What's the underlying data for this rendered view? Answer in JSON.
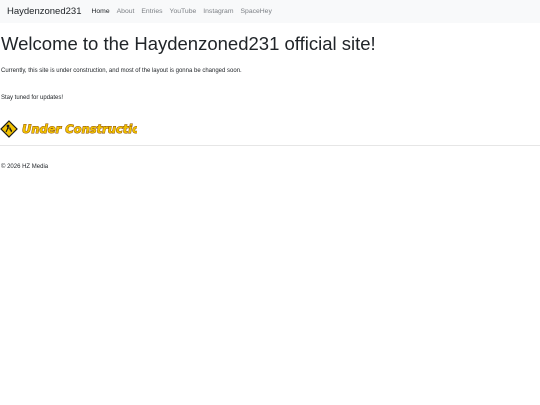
{
  "navbar": {
    "brand": "Haydenzoned231",
    "links": [
      "Home",
      "About",
      "Entries",
      "YouTube",
      "Instagram",
      "SpaceHey"
    ],
    "active": "Home"
  },
  "main": {
    "heading": "Welcome to the Haydenzoned231 official site!",
    "paragraph1": "Currently, this site is under construction, and most of the layout is gonna be changed soon.",
    "paragraph2": "Stay tuned for updates!",
    "banner": {
      "text": "Under Construction",
      "icon": "construction-worker-sign-icon"
    }
  },
  "footer": {
    "text": "© 2026 HZ Media"
  },
  "colors": {
    "navbar_bg": "#f8f9fa",
    "banner_text": "#f2c200",
    "banner_outline": "#8a4a00"
  }
}
